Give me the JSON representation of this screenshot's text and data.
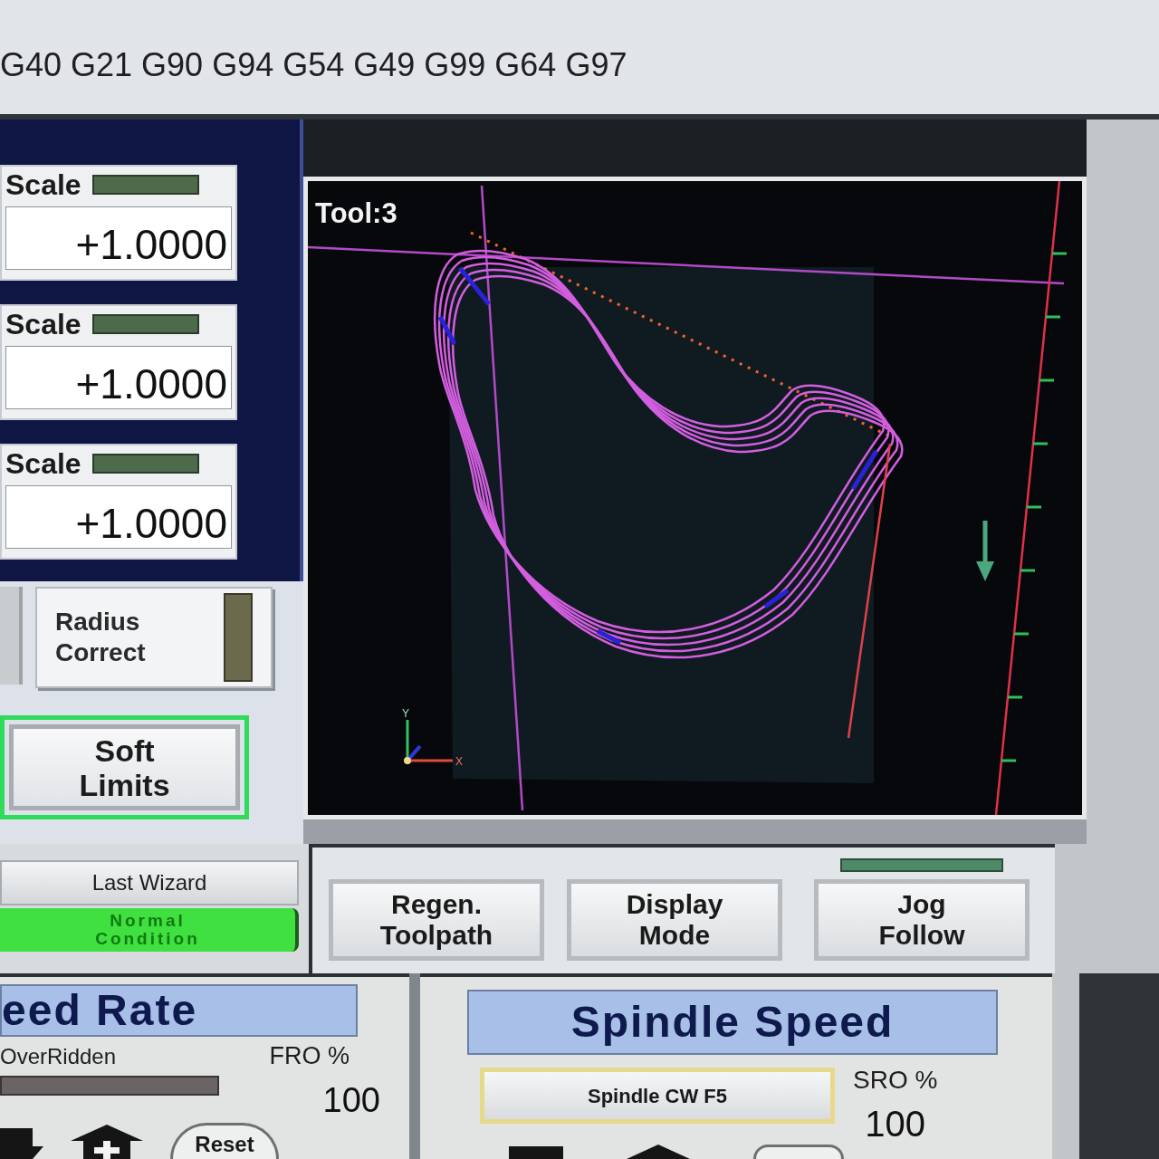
{
  "gcode_line": "G40 G21 G90 G94 G54 G49 G99 G64 G97",
  "scale_dros": [
    {
      "label": "Scale",
      "led_on": false,
      "value": "+1.0000"
    },
    {
      "label": "Scale",
      "led_on": false,
      "value": "+1.0000"
    },
    {
      "label": "Scale",
      "led_on": false,
      "value": "+1.0000"
    }
  ],
  "radius_correct": {
    "label": "Radius Correct",
    "led_on": false
  },
  "soft_limits": {
    "label": "Soft Limits",
    "active": true
  },
  "last_wizard": {
    "label": "Last Wizard"
  },
  "status_led": {
    "label": "Normal Condition",
    "on": true
  },
  "display": {
    "tool_label": "Tool:3",
    "axis_labels": [
      "Y",
      "X"
    ]
  },
  "display_buttons": [
    {
      "kind": "plain",
      "label": "Regen. Toolpath"
    },
    {
      "kind": "plain",
      "label": "Display Mode"
    },
    {
      "kind": "toggle",
      "label": "Jog Follow",
      "led_on": false
    }
  ],
  "feed_rate": {
    "title": "eed Rate",
    "overridden_label": "OverRidden",
    "overridden_on": false,
    "fro_label": "FRO %",
    "fro_value": "100",
    "reset_label": "Reset"
  },
  "spindle_speed": {
    "title": "Spindle Speed",
    "button_label": "Spindle CW F5",
    "sro_label": "SRO %",
    "sro_value": "100"
  }
}
